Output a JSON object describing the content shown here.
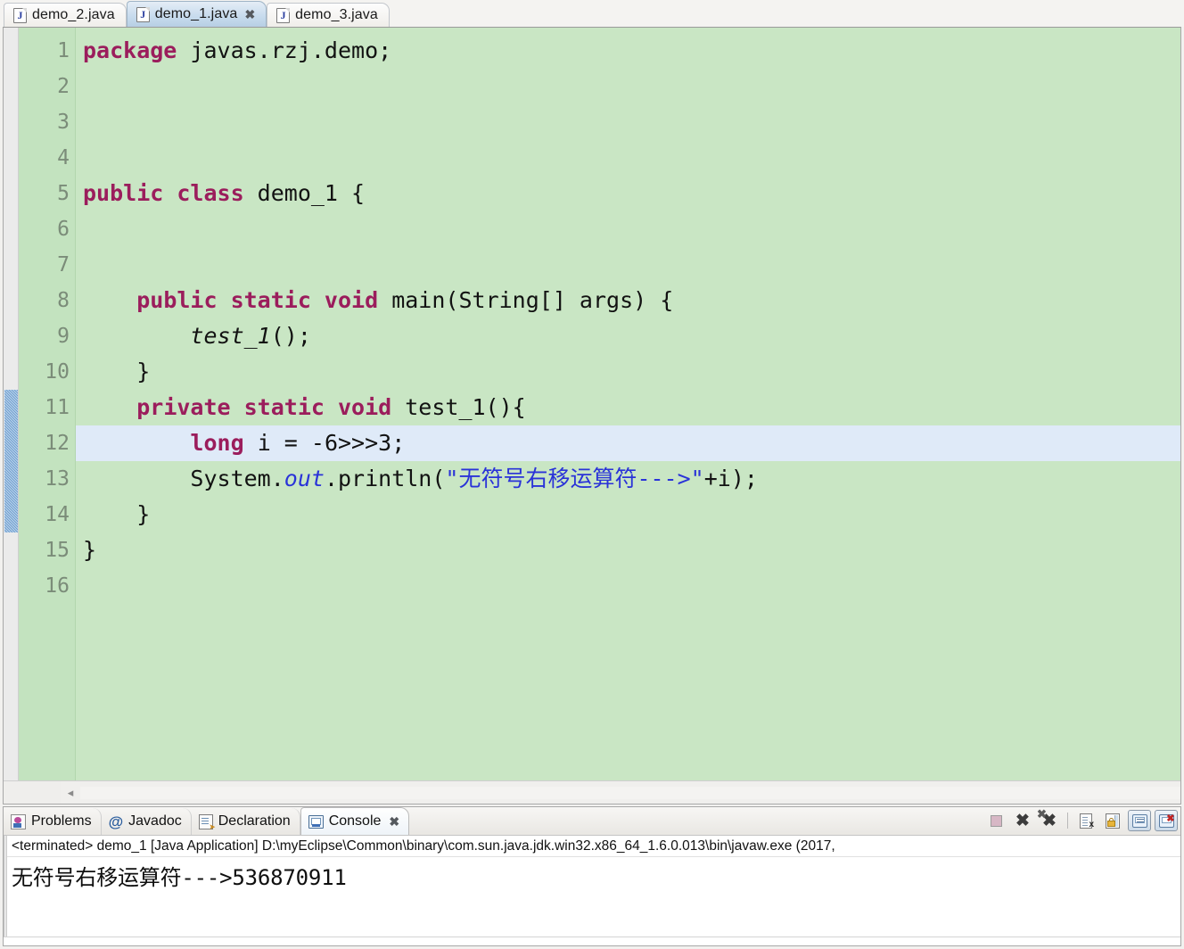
{
  "editor": {
    "tabs": [
      {
        "label": "demo_2.java",
        "icon": "java-file-icon",
        "active": false,
        "closable": false
      },
      {
        "label": "demo_1.java",
        "icon": "java-file-icon",
        "active": true,
        "closable": true,
        "close_glyph": "✖"
      },
      {
        "label": "demo_3.java",
        "icon": "java-file-icon",
        "active": false,
        "closable": false
      }
    ],
    "background_color": "#c9e6c4",
    "current_line_color": "#dfeaf8",
    "keyword_color": "#9b1d5c",
    "string_color": "#2a33d8",
    "change_bar_color": "#6f9fd0",
    "change_bar_start_line": 11,
    "change_bar_end_line": 14,
    "current_line": 12,
    "lines": [
      {
        "n": "1",
        "fold": false,
        "current": false,
        "tokens": [
          {
            "t": "package",
            "c": "kw"
          },
          {
            "t": " javas.rzj.demo;",
            "c": "pln"
          }
        ]
      },
      {
        "n": "2",
        "fold": false,
        "current": false,
        "tokens": []
      },
      {
        "n": "3",
        "fold": false,
        "current": false,
        "tokens": []
      },
      {
        "n": "4",
        "fold": false,
        "current": false,
        "tokens": []
      },
      {
        "n": "5",
        "fold": false,
        "current": false,
        "tokens": [
          {
            "t": "public class",
            "c": "kw"
          },
          {
            "t": " demo_1 {",
            "c": "pln"
          }
        ]
      },
      {
        "n": "6",
        "fold": false,
        "current": false,
        "tokens": []
      },
      {
        "n": "7",
        "fold": false,
        "current": false,
        "tokens": []
      },
      {
        "n": "8",
        "fold": true,
        "current": false,
        "tokens": [
          {
            "t": "    ",
            "c": "pln"
          },
          {
            "t": "public static void",
            "c": "kw"
          },
          {
            "t": " main(String[] args) {",
            "c": "pln"
          }
        ]
      },
      {
        "n": "9",
        "fold": false,
        "current": false,
        "tokens": [
          {
            "t": "        ",
            "c": "pln"
          },
          {
            "t": "test_1",
            "c": "mth"
          },
          {
            "t": "();",
            "c": "pln"
          }
        ]
      },
      {
        "n": "10",
        "fold": false,
        "current": false,
        "tokens": [
          {
            "t": "    }",
            "c": "pln"
          }
        ]
      },
      {
        "n": "11",
        "fold": true,
        "current": false,
        "tokens": [
          {
            "t": "    ",
            "c": "pln"
          },
          {
            "t": "private static void",
            "c": "kw"
          },
          {
            "t": " test_1(){",
            "c": "pln"
          }
        ]
      },
      {
        "n": "12",
        "fold": false,
        "current": true,
        "tokens": [
          {
            "t": "        ",
            "c": "pln"
          },
          {
            "t": "long",
            "c": "kw"
          },
          {
            "t": " i = -6>>>3;",
            "c": "pln"
          }
        ]
      },
      {
        "n": "13",
        "fold": false,
        "current": false,
        "tokens": [
          {
            "t": "        System.",
            "c": "pln"
          },
          {
            "t": "out",
            "c": "stat"
          },
          {
            "t": ".println(",
            "c": "pln"
          },
          {
            "t": "\"无符号右移运算符--->\"",
            "c": "str"
          },
          {
            "t": "+i);",
            "c": "pln"
          }
        ]
      },
      {
        "n": "14",
        "fold": false,
        "current": false,
        "tokens": [
          {
            "t": "    }",
            "c": "pln"
          }
        ]
      },
      {
        "n": "15",
        "fold": false,
        "current": false,
        "tokens": [
          {
            "t": "}",
            "c": "pln"
          }
        ]
      },
      {
        "n": "16",
        "fold": false,
        "current": false,
        "tokens": []
      }
    ],
    "hscroll": {
      "left_arrow": "◂"
    }
  },
  "bottom_panel": {
    "tabs": [
      {
        "label": "Problems",
        "icon": "problems-icon",
        "active": false
      },
      {
        "label": "Javadoc",
        "icon": "at-sign-icon",
        "active": false
      },
      {
        "label": "Declaration",
        "icon": "declaration-icon",
        "active": false
      },
      {
        "label": "Console",
        "icon": "console-icon",
        "active": true,
        "close_glyph": "✖"
      }
    ],
    "toolbar": [
      {
        "name": "terminate-button",
        "icon": "stop-square-icon",
        "framed": false
      },
      {
        "name": "remove-launch-button",
        "icon": "remove-x-icon",
        "framed": false
      },
      {
        "name": "remove-all-launches-button",
        "icon": "remove-all-x-icon",
        "framed": false
      },
      {
        "name": "clear-console-button",
        "icon": "clear-console-icon",
        "framed": false
      },
      {
        "name": "scroll-lock-button",
        "icon": "scroll-lock-icon",
        "framed": false
      },
      {
        "name": "pin-console-button",
        "icon": "pin-console-icon",
        "framed": true
      },
      {
        "name": "display-console-button",
        "icon": "close-console-icon",
        "framed": true
      }
    ],
    "console": {
      "process_line": "<terminated> demo_1 [Java Application] D:\\myEclipse\\Common\\binary\\com.sun.java.jdk.win32.x86_64_1.6.0.013\\bin\\javaw.exe (2017,",
      "output": "无符号右移运算符--->536870911"
    }
  }
}
